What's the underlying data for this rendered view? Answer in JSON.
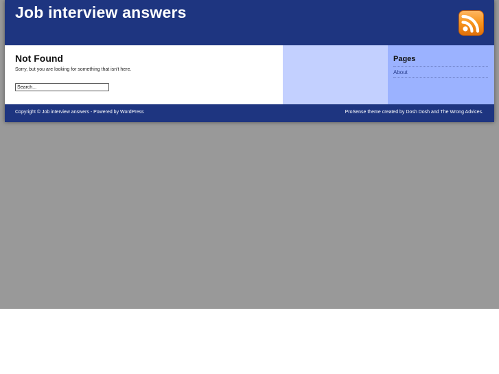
{
  "header": {
    "site_title": "Job interview answers",
    "rss_icon": "rss-feed-icon",
    "background_color": "#1e3580",
    "rss_color": "#f7941d"
  },
  "content": {
    "title": "Not Found",
    "message": "Sorry, but you are looking for something that isn't here.",
    "search": {
      "value": "Search..."
    }
  },
  "sidebar": {
    "pages_title": "Pages",
    "items": [
      {
        "label": "About"
      }
    ],
    "middle_color": "#c3d0ff",
    "sidebar_color": "#9bb2ff"
  },
  "footer": {
    "copyright_prefix": "Copyright © ",
    "site_link": "Job interview answers",
    "powered_by": " - Powered by ",
    "wordpress_link": "WordPress",
    "theme_name": "ProSense",
    "theme_text": " theme created by ",
    "author1": "Dosh Dosh",
    "and_text": " and ",
    "author2": "The Wrong Advices",
    "end_period": "."
  },
  "page_background": "#999999"
}
